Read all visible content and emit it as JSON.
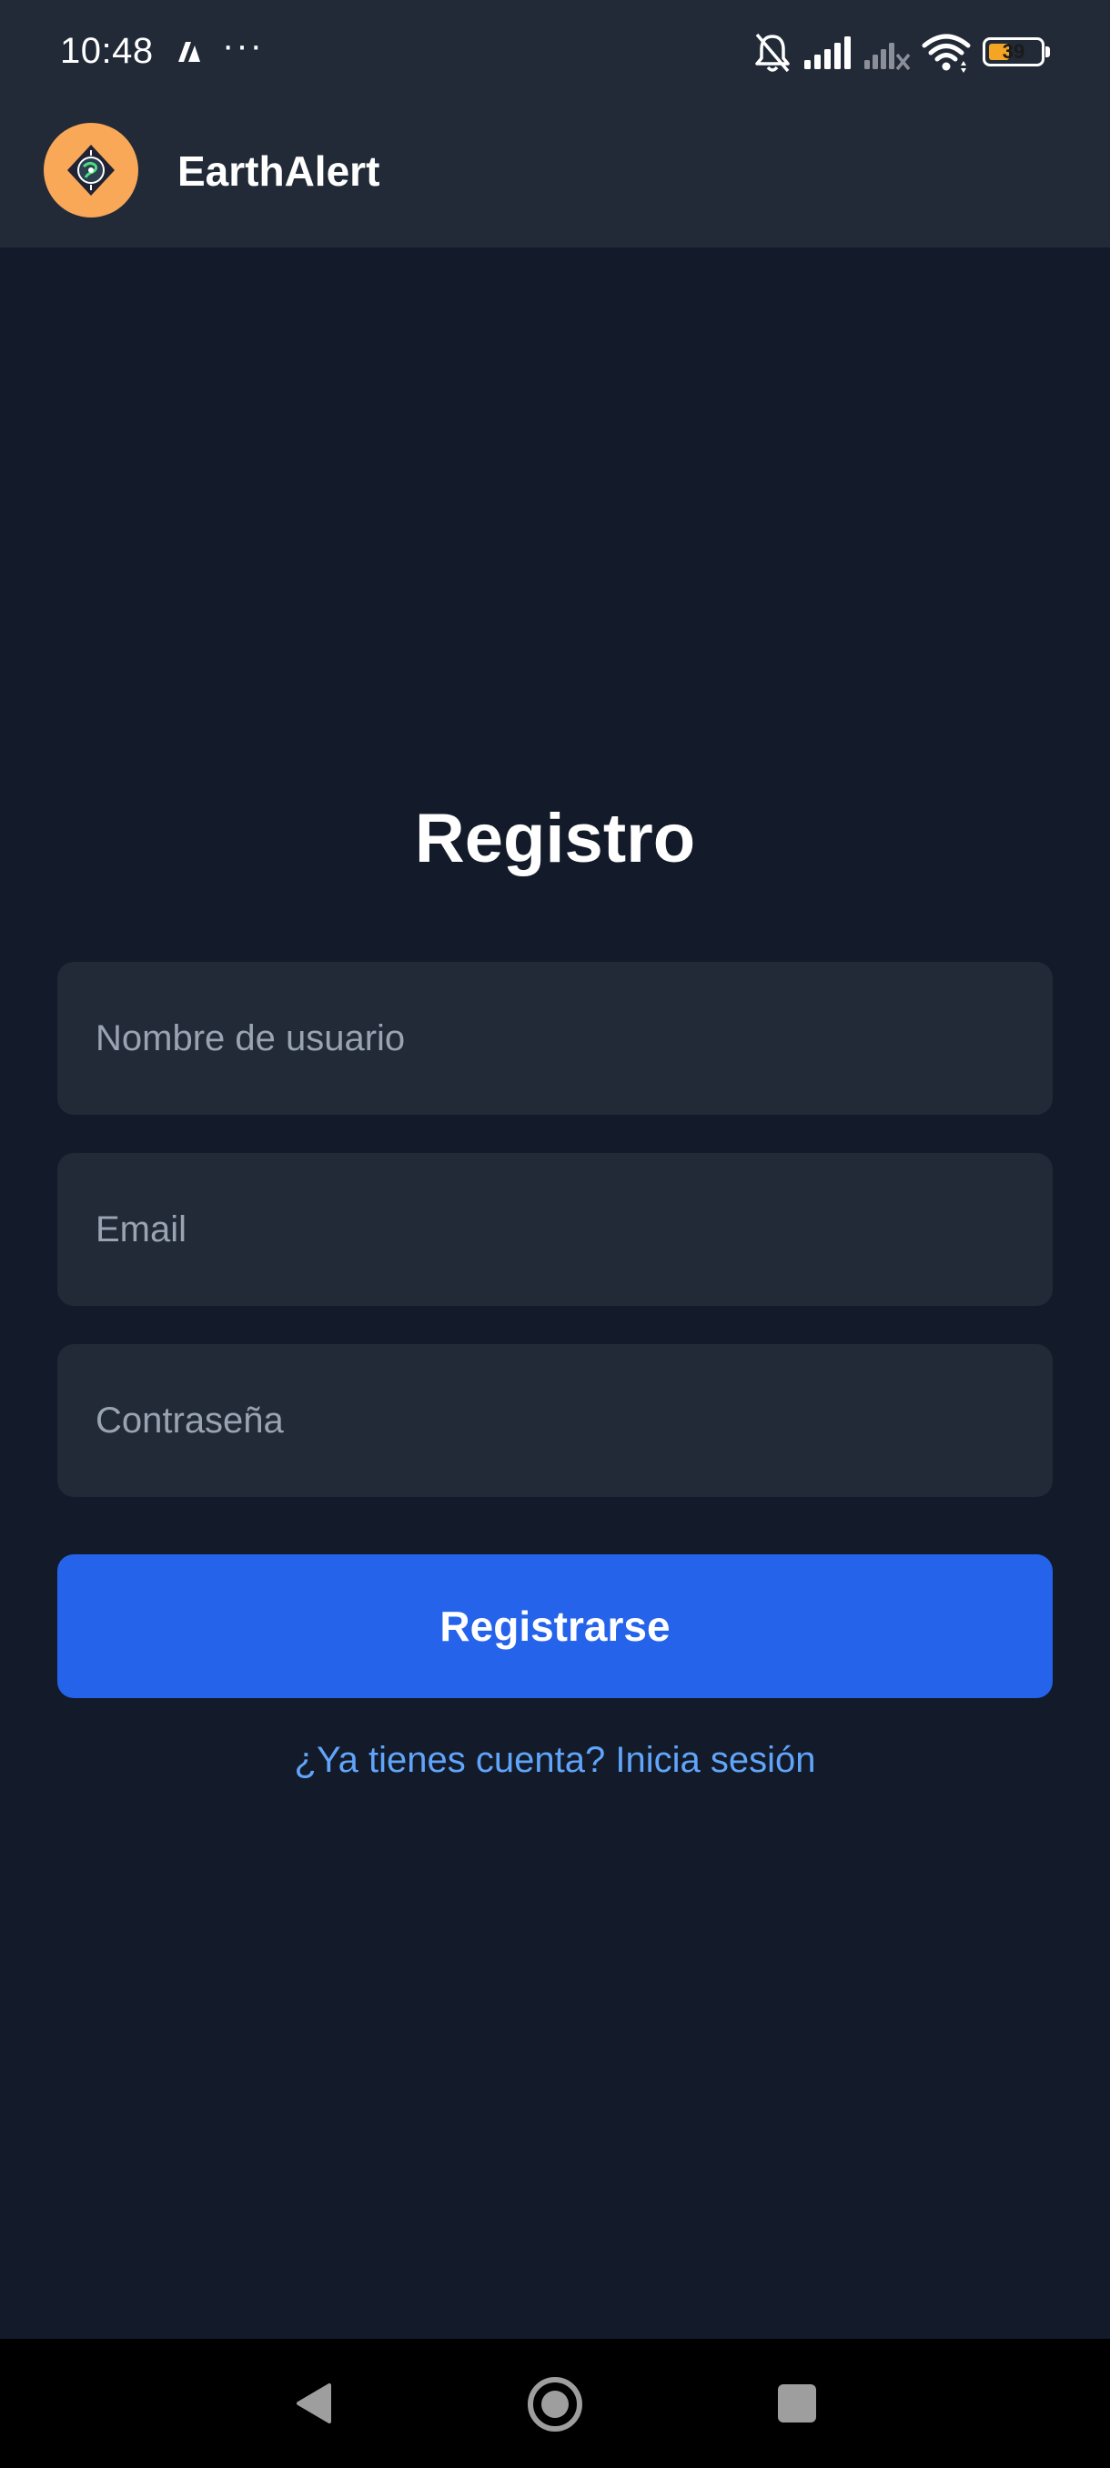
{
  "status_bar": {
    "time": "10:48",
    "more_indicator": "···",
    "battery_level": "39",
    "battery_fraction": 0.39,
    "icons": [
      "notification-app-icon",
      "bell-muted-icon",
      "signal-icon",
      "signal-no-service-icon",
      "wifi-icon",
      "battery-icon"
    ]
  },
  "app_bar": {
    "title": "EarthAlert",
    "logo_icon": "globe-compass-icon",
    "logo_color": "#f9a857"
  },
  "form": {
    "title": "Registro",
    "username_placeholder": "Nombre de usuario",
    "email_placeholder": "Email",
    "password_placeholder": "Contraseña",
    "submit_label": "Registrarse",
    "login_link": "¿Ya tienes cuenta? Inicia sesión"
  },
  "nav_bar": {
    "icons": [
      "back-icon",
      "home-icon",
      "recents-icon"
    ]
  },
  "colors": {
    "background": "#131a29",
    "surface": "#222a38",
    "accent": "#2563eb",
    "link": "#60a5fa"
  }
}
